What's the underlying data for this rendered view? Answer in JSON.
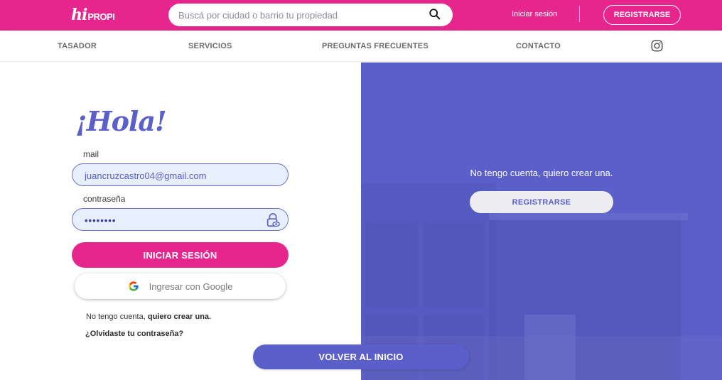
{
  "header": {
    "logo_hi": "hi",
    "logo_propi": "PROPI",
    "search_placeholder": "Buscá por ciudad o barrio tu propiedad",
    "login_link": "Iniciar sesión",
    "register_button": "REGISTRARSE"
  },
  "nav": {
    "items": [
      "TASADOR",
      "SERVICIOS",
      "PREGUNTAS FRECUENTES",
      "CONTACTO"
    ],
    "social_icon": "instagram-icon"
  },
  "login": {
    "greeting": "¡Hola!",
    "mail_label": "mail",
    "mail_value": "juancruzcastro04@gmail.com",
    "password_label": "contraseña",
    "password_value": "••••••••",
    "submit": "INICIAR SESIÓN",
    "google": "Ingresar con Google",
    "no_account_prefix": "No tengo cuenta, ",
    "no_account_link": "quiero crear una.",
    "forgot": "¿Olvidaste tu contraseña?"
  },
  "signup_panel": {
    "text": "No tengo cuenta, quiero crear una.",
    "button": "REGISTRARSE"
  },
  "back_button": "VOLVER AL INICIO",
  "colors": {
    "brand_pink": "#e6268c",
    "brand_purple": "#5a5fc9",
    "input_bg": "#e7eefc"
  }
}
